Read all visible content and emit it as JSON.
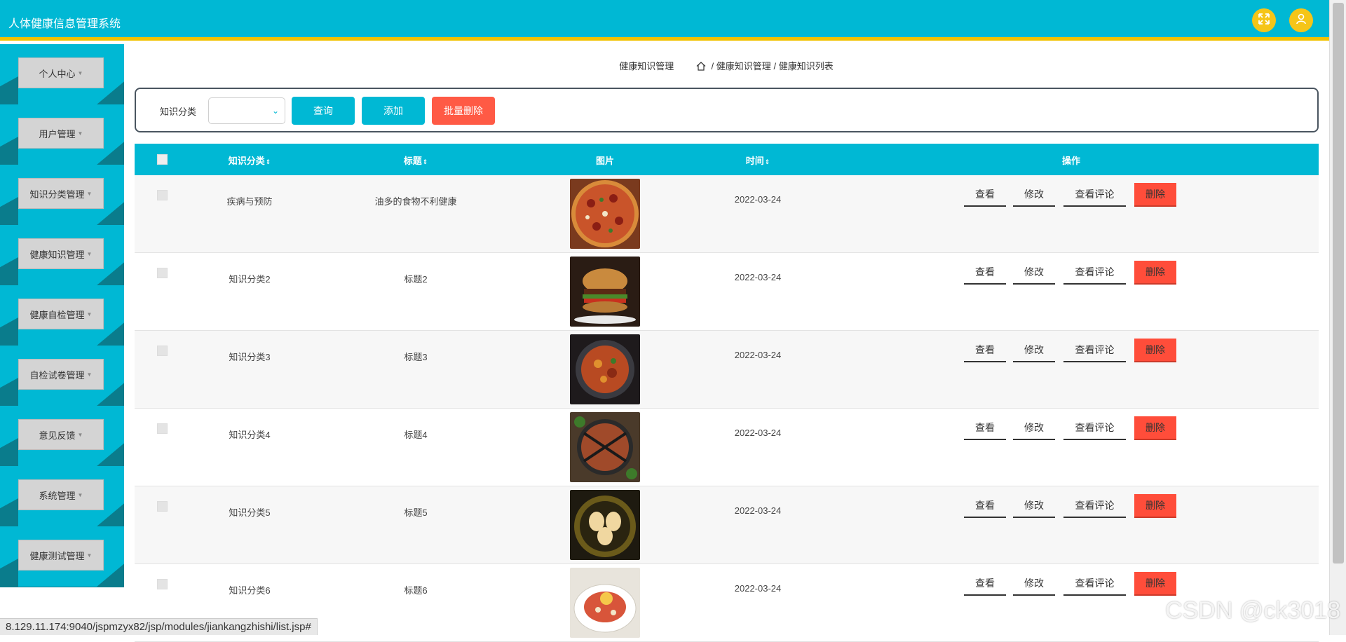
{
  "header": {
    "title": "人体健康信息管理系统",
    "icons": [
      "fullscreen-icon",
      "user-icon"
    ],
    "accent_color": "#00b8d4",
    "strip_color": "#f2c200"
  },
  "sidebar": {
    "items": [
      {
        "label": "个人中心"
      },
      {
        "label": "用户管理"
      },
      {
        "label": "知识分类管理"
      },
      {
        "label": "健康知识管理"
      },
      {
        "label": "健康自检管理"
      },
      {
        "label": "自检试卷管理"
      },
      {
        "label": "意见反馈"
      },
      {
        "label": "系统管理"
      },
      {
        "label": "健康测试管理"
      }
    ]
  },
  "breadcrumb": {
    "page": "健康知识管理",
    "path1": "健康知识管理",
    "path2": "健康知识列表",
    "sep": "/"
  },
  "search": {
    "label": "知识分类",
    "select_value": "",
    "query_label": "查询",
    "add_label": "添加",
    "batch_delete_label": "批量删除"
  },
  "table": {
    "headers": {
      "category": "知识分类",
      "title": "标题",
      "image": "图片",
      "time": "时间",
      "actions": "操作",
      "sort_glyph": "⇕"
    },
    "rows": [
      {
        "category": "疾病与预防",
        "title": "油多的食物不利健康",
        "image": "pizza",
        "time": "2022-03-24"
      },
      {
        "category": "知识分类2",
        "title": "标题2",
        "image": "burger",
        "time": "2022-03-24"
      },
      {
        "category": "知识分类3",
        "title": "标题3",
        "image": "stew",
        "time": "2022-03-24"
      },
      {
        "category": "知识分类4",
        "title": "标题4",
        "image": "grill",
        "time": "2022-03-24"
      },
      {
        "category": "知识分类5",
        "title": "标题5",
        "image": "dumplings",
        "time": "2022-03-24"
      },
      {
        "category": "知识分类6",
        "title": "标题6",
        "image": "pasta",
        "time": "2022-03-24"
      }
    ],
    "actions": {
      "view": "查看",
      "edit": "修改",
      "comments": "查看评论",
      "delete": "删除"
    }
  },
  "statusbar": {
    "url": "8.129.11.174:9040/jspmzyx82/jsp/modules/jiankangzhishi/list.jsp#"
  },
  "watermark": "CSDN @ck3018"
}
